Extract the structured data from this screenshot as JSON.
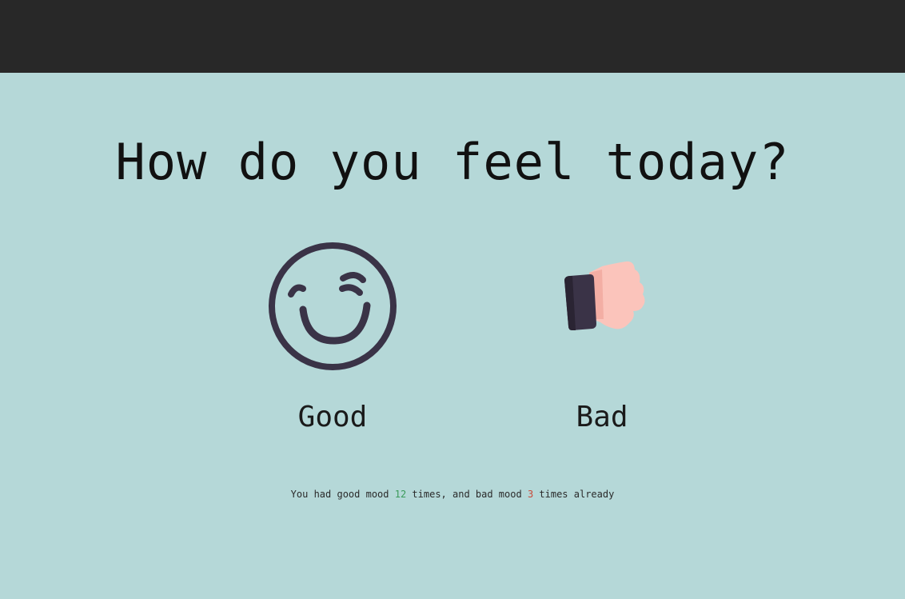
{
  "header": {
    "title": "How do you feel today?"
  },
  "options": {
    "good": {
      "label": "Good",
      "icon": "smiley-face-icon"
    },
    "bad": {
      "label": "Bad",
      "icon": "thumbs-down-hand-icon"
    }
  },
  "summary": {
    "prefix": "You had good mood",
    "good_count": "12",
    "middle": "times, and bad mood",
    "bad_count": "3",
    "suffix": "times already"
  },
  "colors": {
    "top_bar": "#282828",
    "background": "#b5d8d8",
    "icon_dark": "#3a3347",
    "hand_skin": "#fbc4bb",
    "good_count": "#3a9a5a",
    "bad_count": "#c84a3a"
  }
}
